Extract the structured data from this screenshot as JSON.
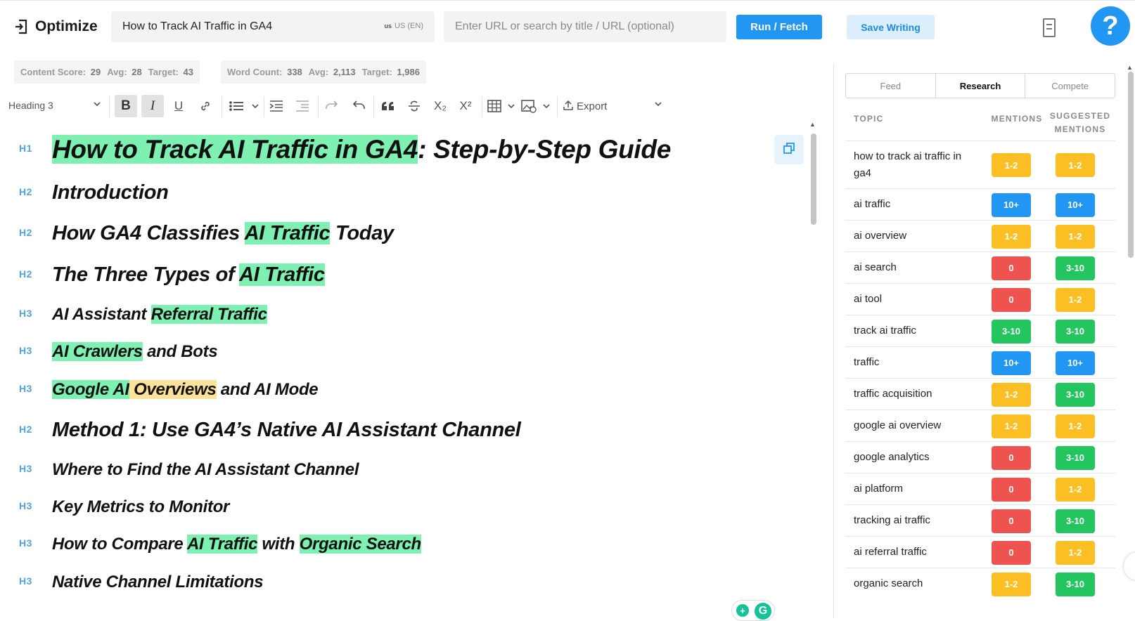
{
  "header": {
    "brand_title": "Optimize",
    "query": "How to Track AI Traffic in GA4",
    "locale_flag": "us",
    "locale": "US (EN)",
    "url_placeholder": "Enter URL or search by title / URL (optional)",
    "run_label": "Run / Fetch",
    "save_label": "Save Writing",
    "help_label": "?"
  },
  "stats": {
    "content_score": {
      "label": "Content Score:",
      "value": "29",
      "avg_label": "Avg:",
      "avg": "28",
      "target_label": "Target:",
      "target": "43"
    },
    "word_count": {
      "label": "Word Count:",
      "value": "338",
      "avg_label": "Avg:",
      "avg": "2,113",
      "target_label": "Target:",
      "target": "1,986"
    }
  },
  "toolbar": {
    "heading_select": "Heading 3",
    "export_label": "Export",
    "icons": [
      "bold-icon",
      "italic-icon",
      "underline-icon",
      "link-icon",
      "bullet-list-icon",
      "indent-icon",
      "outdent-icon",
      "redo-icon",
      "undo-icon",
      "quote-icon",
      "strikethrough-icon",
      "subscript-icon",
      "superscript-icon",
      "table-icon",
      "image-icon",
      "export-icon"
    ],
    "bold_glyph": "B",
    "italic_glyph": "I",
    "underline_glyph": "U",
    "superscript_glyph": "X²",
    "subscript_glyph": "X₂"
  },
  "outline": [
    {
      "tag": "H1",
      "parts": [
        {
          "text": "How to Track AI Traffic in GA4",
          "hl": "g"
        },
        {
          "text": ": Step-by-Step Guide",
          "hl": ""
        }
      ]
    },
    {
      "tag": "H2",
      "parts": [
        {
          "text": "Introduction",
          "hl": ""
        }
      ]
    },
    {
      "tag": "H2",
      "parts": [
        {
          "text": "How GA4 Classifies ",
          "hl": ""
        },
        {
          "text": "AI Traffic",
          "hl": "g"
        },
        {
          "text": " Today",
          "hl": ""
        }
      ]
    },
    {
      "tag": "H2",
      "parts": [
        {
          "text": "The Three Types of ",
          "hl": ""
        },
        {
          "text": "AI Traffic",
          "hl": "g"
        }
      ]
    },
    {
      "tag": "H3",
      "parts": [
        {
          "text": "AI Assistant ",
          "hl": ""
        },
        {
          "text": "Referral Traffic",
          "hl": "g"
        }
      ]
    },
    {
      "tag": "H3",
      "parts": [
        {
          "text": "AI Crawlers",
          "hl": "g"
        },
        {
          "text": " and Bots",
          "hl": ""
        }
      ]
    },
    {
      "tag": "H3",
      "parts": [
        {
          "text": "Google AI",
          "hl": "g"
        },
        {
          "text": " Overviews",
          "hl": "y"
        },
        {
          "text": " and AI Mode",
          "hl": ""
        }
      ]
    },
    {
      "tag": "H2",
      "parts": [
        {
          "text": "Method 1: Use GA4’s Native AI Assistant Channel",
          "hl": ""
        }
      ]
    },
    {
      "tag": "H3",
      "parts": [
        {
          "text": "Where to Find the AI Assistant Channel",
          "hl": ""
        }
      ]
    },
    {
      "tag": "H3",
      "parts": [
        {
          "text": "Key Metrics to Monitor",
          "hl": ""
        }
      ]
    },
    {
      "tag": "H3",
      "parts": [
        {
          "text": "How to Compare ",
          "hl": ""
        },
        {
          "text": "AI Traffic",
          "hl": "g"
        },
        {
          "text": " with ",
          "hl": ""
        },
        {
          "text": "Organic Search",
          "hl": "g"
        }
      ]
    },
    {
      "tag": "H3",
      "parts": [
        {
          "text": "Native Channel Limitations",
          "hl": ""
        }
      ]
    }
  ],
  "panel": {
    "tabs": [
      {
        "label": "Feed",
        "active": false
      },
      {
        "label": "Research",
        "active": true
      },
      {
        "label": "Compete",
        "active": false
      }
    ],
    "columns": {
      "topic": "TOPIC",
      "mentions": "MENTIONS",
      "suggested_1": "SUGGESTED",
      "suggested_2": "MENTIONS"
    },
    "status_colors": {
      "yellow": "#fbbf24",
      "blue": "#2196f3",
      "red": "#ef5350",
      "green": "#22c55e"
    },
    "topics": [
      {
        "topic": "how to track ai traffic in ga4",
        "mentions": "1-2",
        "m_color": "yellow",
        "suggested": "1-2",
        "s_color": "yellow"
      },
      {
        "topic": "ai traffic",
        "mentions": "10+",
        "m_color": "blue",
        "suggested": "10+",
        "s_color": "blue"
      },
      {
        "topic": "ai overview",
        "mentions": "1-2",
        "m_color": "yellow",
        "suggested": "1-2",
        "s_color": "yellow"
      },
      {
        "topic": "ai search",
        "mentions": "0",
        "m_color": "red",
        "suggested": "3-10",
        "s_color": "green"
      },
      {
        "topic": "ai tool",
        "mentions": "0",
        "m_color": "red",
        "suggested": "1-2",
        "s_color": "yellow"
      },
      {
        "topic": "track ai traffic",
        "mentions": "3-10",
        "m_color": "green",
        "suggested": "3-10",
        "s_color": "green"
      },
      {
        "topic": "traffic",
        "mentions": "10+",
        "m_color": "blue",
        "suggested": "10+",
        "s_color": "blue"
      },
      {
        "topic": "traffic acquisition",
        "mentions": "1-2",
        "m_color": "yellow",
        "suggested": "3-10",
        "s_color": "green"
      },
      {
        "topic": "google ai overview",
        "mentions": "1-2",
        "m_color": "yellow",
        "suggested": "1-2",
        "s_color": "yellow"
      },
      {
        "topic": "google analytics",
        "mentions": "0",
        "m_color": "red",
        "suggested": "3-10",
        "s_color": "green"
      },
      {
        "topic": "ai platform",
        "mentions": "0",
        "m_color": "red",
        "suggested": "1-2",
        "s_color": "yellow"
      },
      {
        "topic": "tracking ai traffic",
        "mentions": "0",
        "m_color": "red",
        "suggested": "3-10",
        "s_color": "green"
      },
      {
        "topic": "ai referral traffic",
        "mentions": "0",
        "m_color": "red",
        "suggested": "1-2",
        "s_color": "yellow"
      },
      {
        "topic": "organic search",
        "mentions": "1-2",
        "m_color": "yellow",
        "suggested": "3-10",
        "s_color": "green"
      }
    ]
  }
}
